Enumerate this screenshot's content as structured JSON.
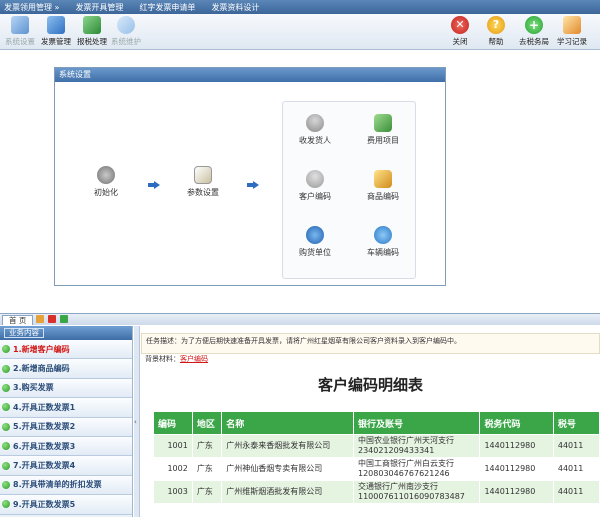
{
  "menu": {
    "items": [
      "发票领用管理 »",
      "发票开具管理",
      "红字发票申请单",
      "发票资料设计"
    ]
  },
  "toolbar": {
    "left": [
      {
        "label": "系统设置",
        "icon": "settings-icon",
        "color": "#7aa9e0",
        "disabled": true
      },
      {
        "label": "发票管理",
        "icon": "invoice-icon",
        "color": "#4f8fd4",
        "disabled": false
      },
      {
        "label": "报税处理",
        "icon": "tax-icon",
        "color": "#3ea24a",
        "disabled": false
      },
      {
        "label": "系统维护",
        "icon": "maintenance-icon",
        "color": "#9ec7f0",
        "disabled": true
      }
    ],
    "right": [
      {
        "label": "关闭",
        "icon": "close-icon",
        "color": "#d9302c"
      },
      {
        "label": "帮助",
        "icon": "help-icon",
        "color": "#f0b020"
      },
      {
        "label": "去税务局",
        "icon": "tax-office-icon",
        "color": "#3bb54a"
      },
      {
        "label": "学习记录",
        "icon": "study-record-icon",
        "color": "#e08a2a"
      }
    ]
  },
  "settings_panel": {
    "title": "系统设置",
    "flow": [
      {
        "label": "初始化",
        "icon": "gears-icon"
      },
      {
        "label": "参数设置",
        "icon": "parameter-icon"
      }
    ],
    "items": [
      {
        "label": "收发货人",
        "icon": "person-icon"
      },
      {
        "label": "费用项目",
        "icon": "expense-icon"
      },
      {
        "label": "客户编码",
        "icon": "customer-icon"
      },
      {
        "label": "商品编码",
        "icon": "goods-icon"
      },
      {
        "label": "购货单位",
        "icon": "buyer-icon"
      },
      {
        "label": "车辆编码",
        "icon": "vehicle-icon"
      }
    ]
  },
  "bottom_tab": {
    "label": "首 页"
  },
  "left_nav": {
    "header": "业务内容",
    "items": [
      {
        "label": "1.新增客户编码",
        "active": true
      },
      {
        "label": "2.新增商品编码",
        "active": false
      },
      {
        "label": "3.购买发票",
        "active": false
      },
      {
        "label": "4.开具正数发票1",
        "active": false
      },
      {
        "label": "5.开具正数发票2",
        "active": false
      },
      {
        "label": "6.开具正数发票3",
        "active": false
      },
      {
        "label": "7.开具正数发票4",
        "active": false
      },
      {
        "label": "8.开具带清单的折扣发票",
        "active": false
      },
      {
        "label": "9.开具正数发票5",
        "active": false
      }
    ]
  },
  "content": {
    "task_label": "任务描述：",
    "task_text": "为了方便后期快速准备开具发票，请将广州红星烟草有限公司客户资料录入到客户编码中。",
    "background_label": "背景材料：",
    "background_link": "客户编码",
    "doc_title": "客户编码明细表",
    "table": {
      "headers": [
        "编码",
        "地区",
        "名称",
        "银行及账号",
        "税务代码",
        "税号"
      ],
      "rows": [
        [
          "1001",
          "广东",
          "广州永泰来香烟批发有限公司",
          "中国农业银行广州天河支行 234021209433341",
          "1440112980",
          "44011"
        ],
        [
          "1002",
          "广东",
          "广州神仙香烟专卖有限公司",
          "中国工商银行广州白云支行 120803046767621246",
          "1440112980",
          "44011"
        ],
        [
          "1003",
          "广东",
          "广州维斯烟酒批发有限公司",
          "交通银行广州南沙支行 110007611016090783487",
          "1440112980",
          "44011"
        ]
      ]
    }
  }
}
